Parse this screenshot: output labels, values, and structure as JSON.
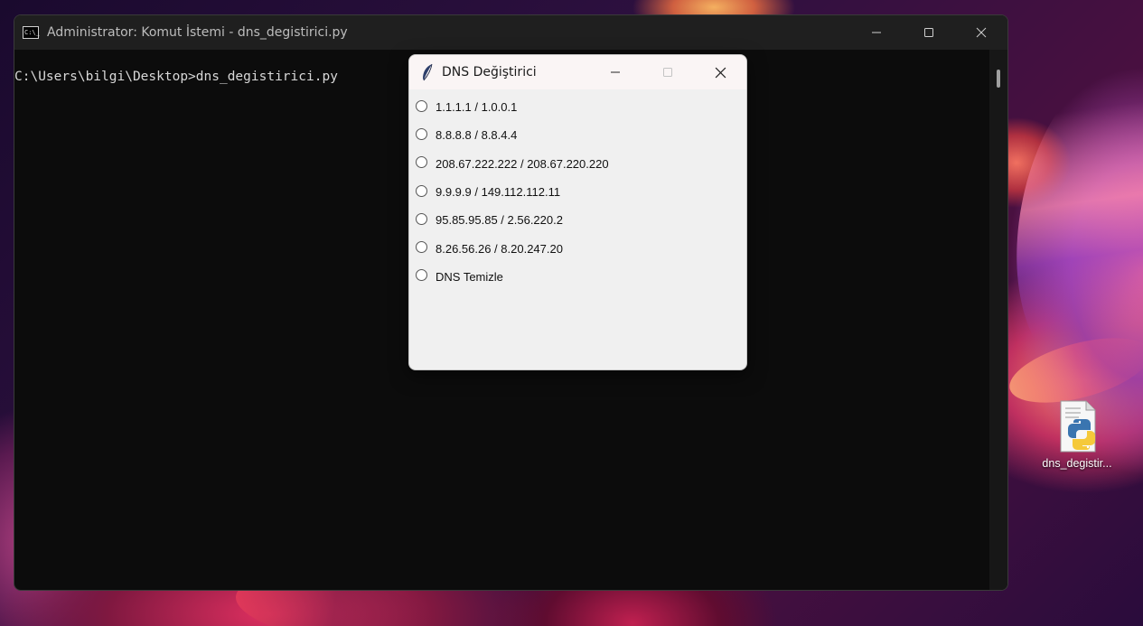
{
  "console": {
    "title": "Administrator: Komut İstemi - dns_degistirici.py",
    "icon_text": "C:\\_",
    "prompt_line": "C:\\Users\\bilgi\\Desktop>dns_degistirici.py"
  },
  "dialog": {
    "title": "DNS Değiştirici",
    "options": [
      {
        "label": "1.1.1.1 / 1.0.0.1",
        "selected": false
      },
      {
        "label": "8.8.8.8 / 8.8.4.4",
        "selected": false
      },
      {
        "label": "208.67.222.222 / 208.67.220.220",
        "selected": false
      },
      {
        "label": "9.9.9.9 / 149.112.112.11",
        "selected": false
      },
      {
        "label": "95.85.95.85 / 2.56.220.2",
        "selected": false
      },
      {
        "label": "8.26.56.26 / 8.20.247.20",
        "selected": false
      },
      {
        "label": "DNS Temizle",
        "selected": false
      }
    ]
  },
  "desktop": {
    "icon_label": "dns_degistir..."
  },
  "colors": {
    "console_bg": "#0c0c0c",
    "titlebar_dark": "#1f1f1f",
    "dialog_bg": "#f0f0f0"
  }
}
